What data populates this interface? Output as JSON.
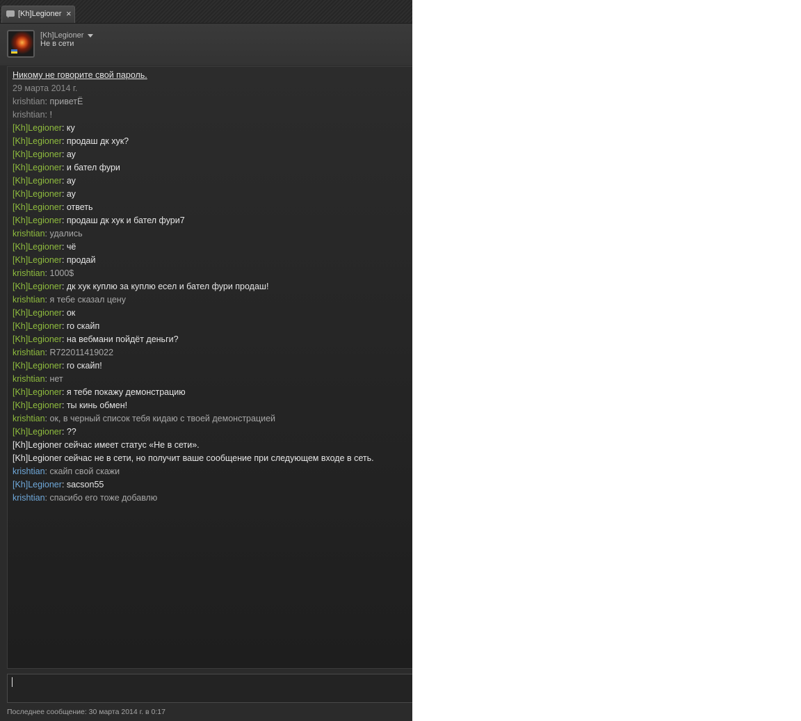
{
  "tab": {
    "title": "[Kh]Legioner",
    "close_glyph": "×",
    "icon": "chat-bubble-icon"
  },
  "header": {
    "name": "[Kh]Legioner",
    "status": "Не в сети",
    "avatar_icon": "avatar"
  },
  "chat": {
    "warning": "Никому не говорите свой пароль.",
    "date": "29 марта 2014 г.",
    "messages": [
      {
        "author": "krishtian",
        "text": ": приветЁ"
      },
      {
        "author": "krishtian",
        "text": ": !"
      },
      {
        "author": "[Kh]Legioner",
        "text": ": ку"
      },
      {
        "author": "[Kh]Legioner",
        "text": ": продаш дк хук?"
      },
      {
        "author": "[Kh]Legioner",
        "text": ": ау"
      },
      {
        "author": "[Kh]Legioner",
        "text": ": и бател фури"
      },
      {
        "author": "[Kh]Legioner",
        "text": ": ау"
      },
      {
        "author": "[Kh]Legioner",
        "text": ": ау"
      },
      {
        "author": "[Kh]Legioner",
        "text": ": ответь"
      },
      {
        "author": "[Kh]Legioner",
        "text": ": продаш дк хук и бател фури7"
      },
      {
        "author": "krishtian",
        "text": ": удались"
      },
      {
        "author": "[Kh]Legioner",
        "text": ": чё"
      },
      {
        "author": "[Kh]Legioner",
        "text": ": продай"
      },
      {
        "author": "krishtian",
        "text": ": 1000$"
      },
      {
        "author": "[Kh]Legioner",
        "text": ": дк хук куплю за куплю есел и бател фури продаш!"
      },
      {
        "author": "krishtian",
        "text": ": я тебе сказал цену"
      },
      {
        "author": "[Kh]Legioner",
        "text": ": ок"
      },
      {
        "author": "[Kh]Legioner",
        "text": ": го скайп"
      },
      {
        "author": "[Kh]Legioner",
        "text": ": на вебмани пойдёт деньги?"
      },
      {
        "author": "krishtian",
        "text": ": R722011419022"
      },
      {
        "author": "[Kh]Legioner",
        "text": ": го скайп!"
      },
      {
        "author": "krishtian",
        "text": ": нет"
      },
      {
        "author": "[Kh]Legioner",
        "text": ": я тебе покажу демонстрацию"
      },
      {
        "author": "[Kh]Legioner",
        "text": ": ты кинь обмен!"
      },
      {
        "author": "krishtian",
        "text": ": ок, в черный список тебя кидаю с твоей демонстрацией"
      },
      {
        "author": "[Kh]Legioner",
        "text": ": ??"
      },
      {
        "author": "",
        "text": "[Kh]Legioner сейчас имеет статус «Не в сети»."
      },
      {
        "author": "",
        "text": "[Kh]Legioner сейчас не в сети, но получит ваше сообщение при следующем входе в сеть."
      },
      {
        "author": "krishtian",
        "text": ": скайп свой скажи"
      },
      {
        "author": "[Kh]Legioner",
        "text": ": sacson55"
      },
      {
        "author": "krishtian",
        "text": ": спасибо его тоже добавлю"
      }
    ]
  },
  "input": {
    "value": "",
    "placeholder": ""
  },
  "footer": {
    "last_message": "Последнее сообщение: 30 марта 2014 г. в 0:17"
  },
  "colors": {
    "legioner_name": "#8fbc3e",
    "krishtian_name_old": "#8f8f8f",
    "krishtian_name": "#8fbc3e",
    "name_new": "#6fa8d9",
    "background": "#2b2b2b"
  }
}
